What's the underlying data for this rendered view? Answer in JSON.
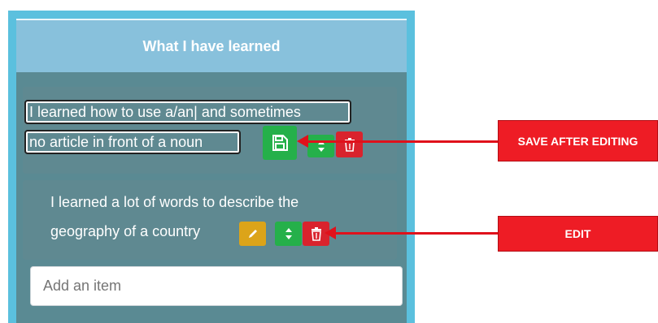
{
  "panel": {
    "title": "What I have learned"
  },
  "items": [
    {
      "line1": "I learned how to use a/an| and sometimes",
      "line2": "no article in front of a noun",
      "mode": "editing"
    },
    {
      "line1": "I learned a lot of words to describe the",
      "line2": "geography of a country",
      "mode": "view"
    }
  ],
  "add_input": {
    "placeholder": "Add an item"
  },
  "callouts": {
    "save": "SAVE AFTER EDITING",
    "edit": "EDIT"
  },
  "icons": {
    "save": "floppy-disk-icon",
    "edit": "pencil-icon",
    "move": "up-down-arrows-icon",
    "delete": "trash-icon"
  },
  "colors": {
    "accent": "#5bc0de",
    "header": "#88c1dc",
    "card": "#5f8991",
    "green": "#25b04a",
    "red": "#d9232d",
    "yellow": "#dca419",
    "callout": "#ee1c25"
  }
}
